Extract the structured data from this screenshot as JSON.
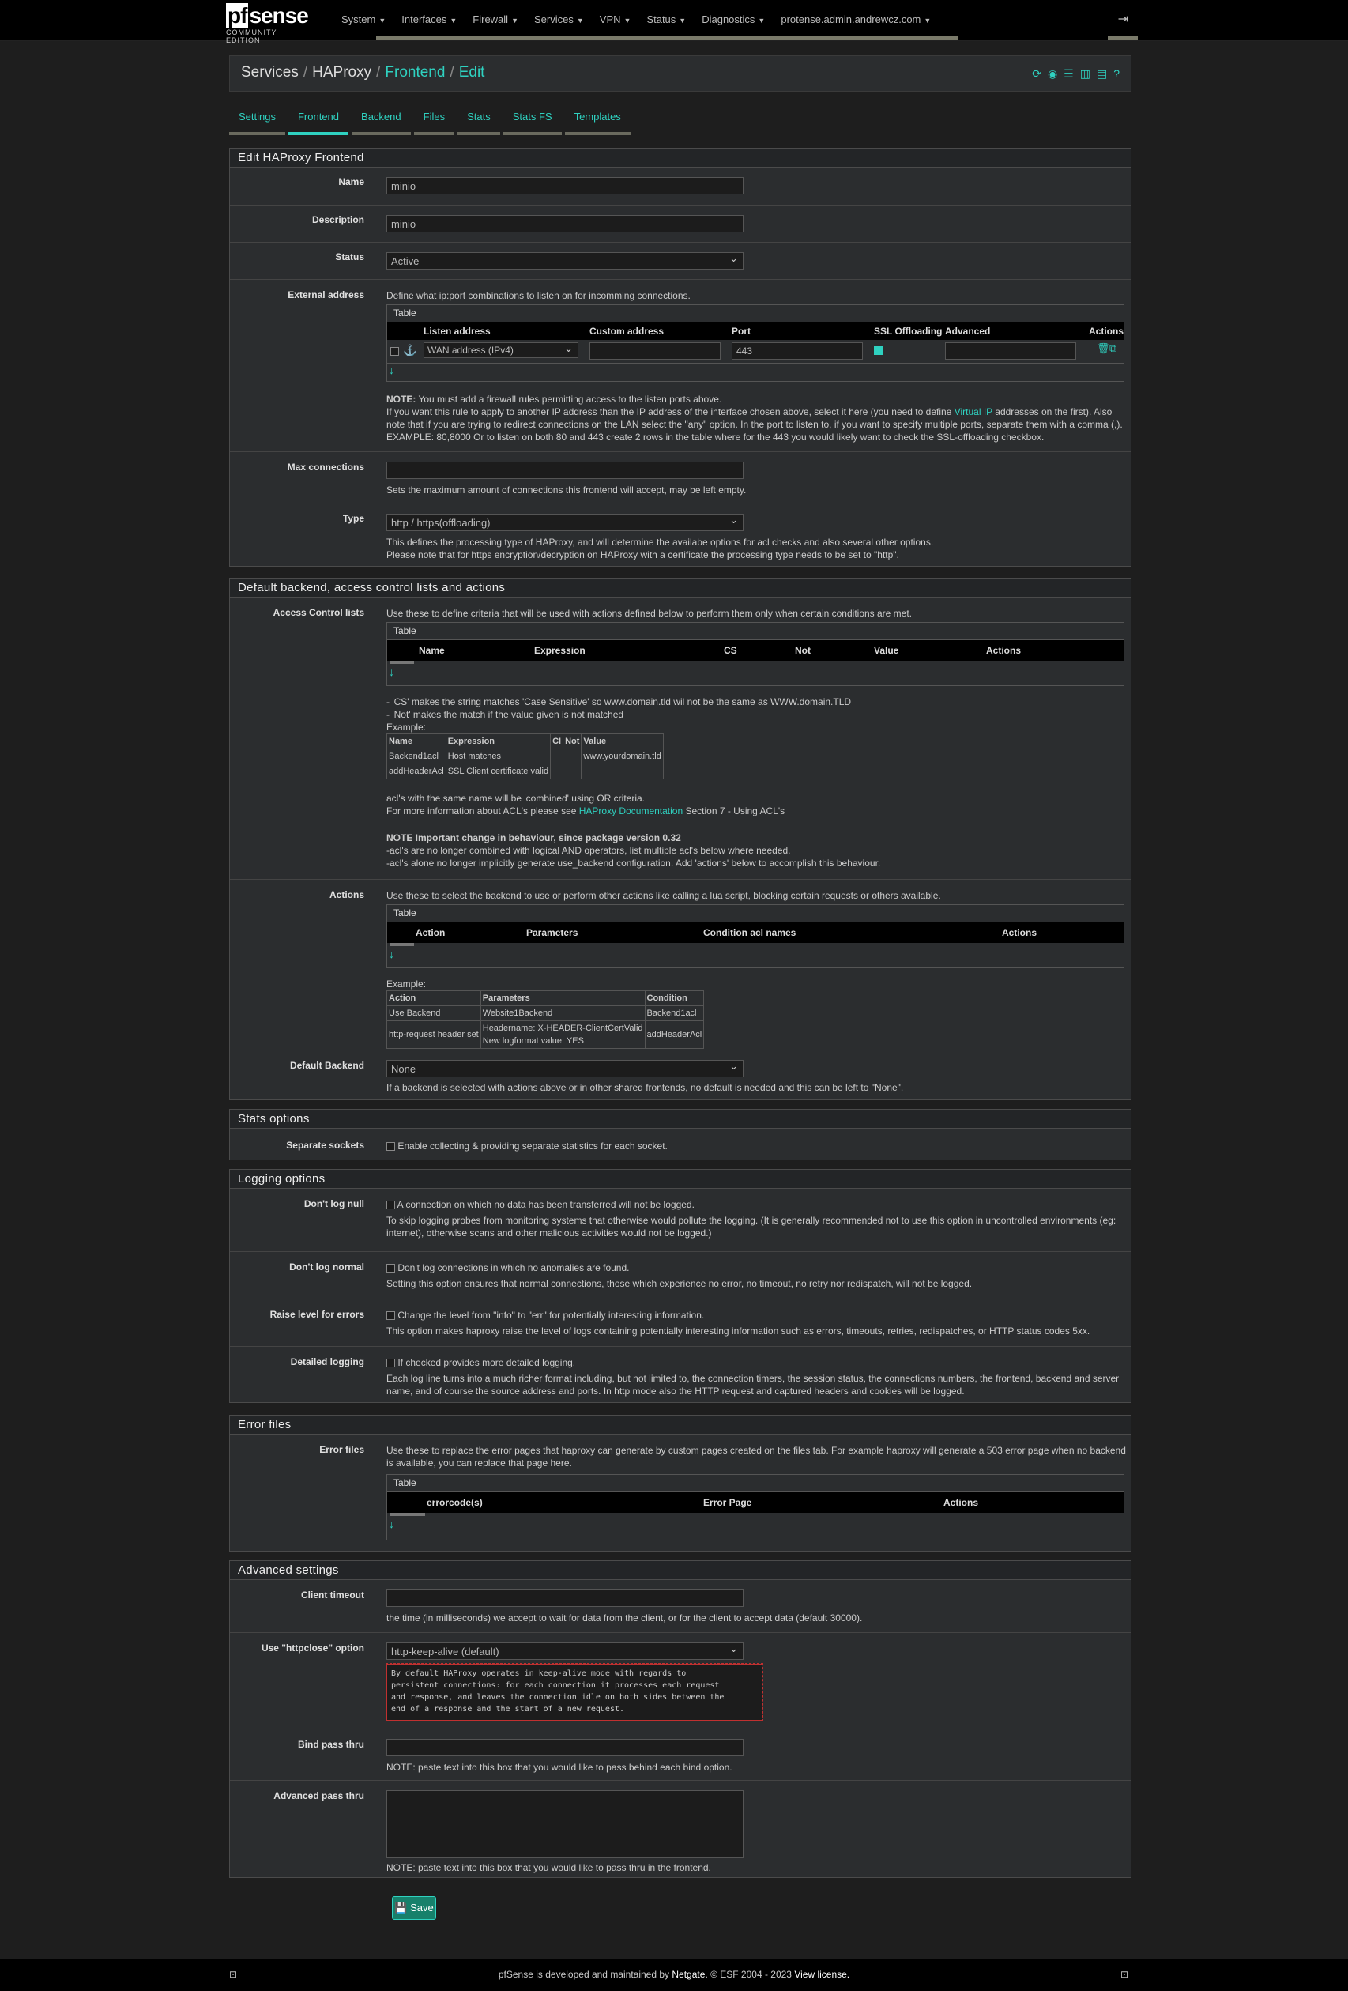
{
  "brand": {
    "logo": "sense",
    "logo_box": "pf",
    "edition": "COMMUNITY EDITION"
  },
  "nav": [
    "System",
    "Interfaces",
    "Firewall",
    "Services",
    "VPN",
    "Status",
    "Diagnostics",
    "protense.admin.andrewcz.com"
  ],
  "breadcrumb": {
    "a": "Services",
    "b": "HAProxy",
    "c": "Frontend",
    "d": "Edit"
  },
  "tabs": [
    "Settings",
    "Frontend",
    "Backend",
    "Files",
    "Stats",
    "Stats FS",
    "Templates"
  ],
  "active_tab": 1,
  "edit": {
    "title": "Edit HAProxy Frontend",
    "name_label": "Name",
    "name_value": "minio",
    "desc_label": "Description",
    "desc_value": "minio",
    "status_label": "Status",
    "status_value": "Active",
    "ext_label": "External address",
    "ext_help": "Define what ip:port combinations to listen on for incomming connections.",
    "table_title": "Table",
    "ext_cols": [
      "Listen address",
      "Custom address",
      "Port",
      "SSL Offloading",
      "Advanced",
      "Actions"
    ],
    "ext_listen": "WAN address (IPv4)",
    "ext_port": "443",
    "note_bold": "NOTE:",
    "note_text": " You must add a firewall rules permitting access to the listen ports above.",
    "note_l2a": "If you want this rule to apply to another IP address than the IP address of the interface chosen above, select it here (you need to define ",
    "note_link": "Virtual IP",
    "note_l2b": " addresses on the first). Also",
    "note_l3": "note that if you are trying to redirect connections on the LAN select the \"any\" option. In the port to listen to, if you want to specify multiple ports, separate them with a comma (,).",
    "note_l4": "EXAMPLE: 80,8000 Or to listen on both 80 and 443 create 2 rows in the table where for the 443 you would likely want to check the SSL-offloading checkbox.",
    "maxconn_label": "Max connections",
    "maxconn_help": "Sets the maximum amount of connections this frontend will accept, may be left empty.",
    "type_label": "Type",
    "type_value": "http / https(offloading)",
    "type_help1": "This defines the processing type of HAProxy, and will determine the availabe options for acl checks and also several other options.",
    "type_help2": "Please note that for https encryption/decryption on HAProxy with a certificate the processing type needs to be set to \"http\"."
  },
  "defaults": {
    "title": "Default backend, access control lists and actions",
    "acl_label": "Access Control lists",
    "acl_help": "Use these to define criteria that will be used with actions defined below to perform them only when certain conditions are met.",
    "acl_cols": [
      "Name",
      "Expression",
      "CS",
      "Not",
      "Value",
      "Actions"
    ],
    "acl_n1": "- 'CS' makes the string matches 'Case Sensitive' so www.domain.tld wil not be the same as WWW.domain.TLD",
    "acl_n2": "- 'Not' makes the match if the value given is not matched",
    "example": "Example:",
    "ex_head": [
      "Name",
      "Expression",
      "CI",
      "Not",
      "Value"
    ],
    "ex_rows": [
      [
        "Backend1acl",
        "Host matches",
        "",
        "",
        "www.yourdomain.tld"
      ],
      [
        "addHeaderAcl",
        "SSL Client certificate valid",
        "",
        "",
        ""
      ]
    ],
    "acl_n3": "acl's with the same name will be 'combined' using OR criteria.",
    "acl_n4a": "For more information about ACL's please see ",
    "acl_link": "HAProxy Documentation",
    "acl_n4b": " Section 7 - Using ACL's",
    "acl_imp": "NOTE Important change in behaviour, since package version 0.32",
    "acl_imp1": "-acl's are no longer combined with logical AND operators, list multiple acl's below where needed.",
    "acl_imp2": "-acl's alone no longer implicitly generate use_backend configuration. Add 'actions' below to accomplish this behaviour.",
    "act_label": "Actions",
    "act_help": "Use these to select the backend to use or perform other actions like calling a lua script, blocking certain requests or others available.",
    "act_cols": [
      "Action",
      "Parameters",
      "Condition acl names",
      "Actions"
    ],
    "act_head": [
      "Action",
      "Parameters",
      "Condition"
    ],
    "act_r1": [
      "Use Backend",
      "Website1Backend",
      "Backend1acl"
    ],
    "act_r2": [
      "http-request header set",
      "Headername: X-HEADER-ClientCertValid",
      "New logformat value: YES",
      "addHeaderAcl"
    ],
    "defb_label": "Default Backend",
    "defb_value": "None",
    "defb_help": "If a backend is selected with actions above or in other shared frontends, no default is needed and this can be left to \"None\"."
  },
  "stats": {
    "title": "Stats options",
    "sock_label": "Separate sockets",
    "sock_help": "Enable collecting & providing separate statistics for each socket."
  },
  "logging": {
    "title": "Logging options",
    "null_label": "Don't log null",
    "null_cb": "A connection on which no data has been transferred will not be logged.",
    "null_h1": "To skip logging probes from monitoring systems that otherwise would pollute the logging. (It is generally recommended not to use this option in uncontrolled environments (eg:",
    "null_h2": "internet), otherwise scans and other malicious activities would not be logged.)",
    "norm_label": "Don't log normal",
    "norm_cb": "Don't log connections in which no anomalies are found.",
    "norm_h": "Setting this option ensures that normal connections, those which experience no error, no timeout, no retry nor redispatch, will not be logged.",
    "raise_label": "Raise level for errors",
    "raise_cb": "Change the level from \"info\" to \"err\" for potentially interesting information.",
    "raise_h": "This option makes haproxy raise the level of logs containing potentially interesting information such as errors, timeouts, retries, redispatches, or HTTP status codes 5xx.",
    "det_label": "Detailed logging",
    "det_cb": "If checked provides more detailed logging.",
    "det_h1": "Each log line turns into a much richer format including, but not limited to, the connection timers, the session status, the connections numbers, the frontend, backend and server",
    "det_h2": "name, and of course the source address and ports. In http mode also the HTTP request and captured headers and cookies will be logged."
  },
  "errors": {
    "title": "Error files",
    "label": "Error files",
    "help1": "Use these to replace the error pages that haproxy can generate by custom pages created on the files tab. For example haproxy will generate a 503 error page when no backend",
    "help2": "is available, you can replace that page here.",
    "cols": [
      "errorcode(s)",
      "Error Page",
      "Actions"
    ]
  },
  "advanced": {
    "title": "Advanced settings",
    "ct_label": "Client timeout",
    "ct_help": "the time (in milliseconds) we accept to wait for data from the client, or for the client to accept data (default 30000).",
    "hc_label": "Use \"httpclose\" option",
    "hc_value": "http-keep-alive (default)",
    "hc_text1": "By default HAProxy operates in keep-alive mode with regards to",
    "hc_text2": "persistent connections: for each connection it processes each request",
    "hc_text3": "and response, and leaves the connection idle on both sides between the",
    "hc_text4": "end of a response and the start of a new request.",
    "bind_label": "Bind pass thru",
    "bind_help": "NOTE: paste text into this box that you would like to pass behind each bind option.",
    "adv_label": "Advanced pass thru",
    "adv_help": "NOTE: paste text into this box that you would like to pass thru in the frontend."
  },
  "save_label": "Save",
  "footer": {
    "a": "pfSense",
    "b": " is developed and maintained by ",
    "c": "Netgate.",
    "d": " © ESF 2004 - 2023 ",
    "e": "View license."
  },
  "colors": {
    "accent": "#2fd1c0",
    "bg": "#1e1e1e",
    "panel": "#2b2d2f"
  }
}
